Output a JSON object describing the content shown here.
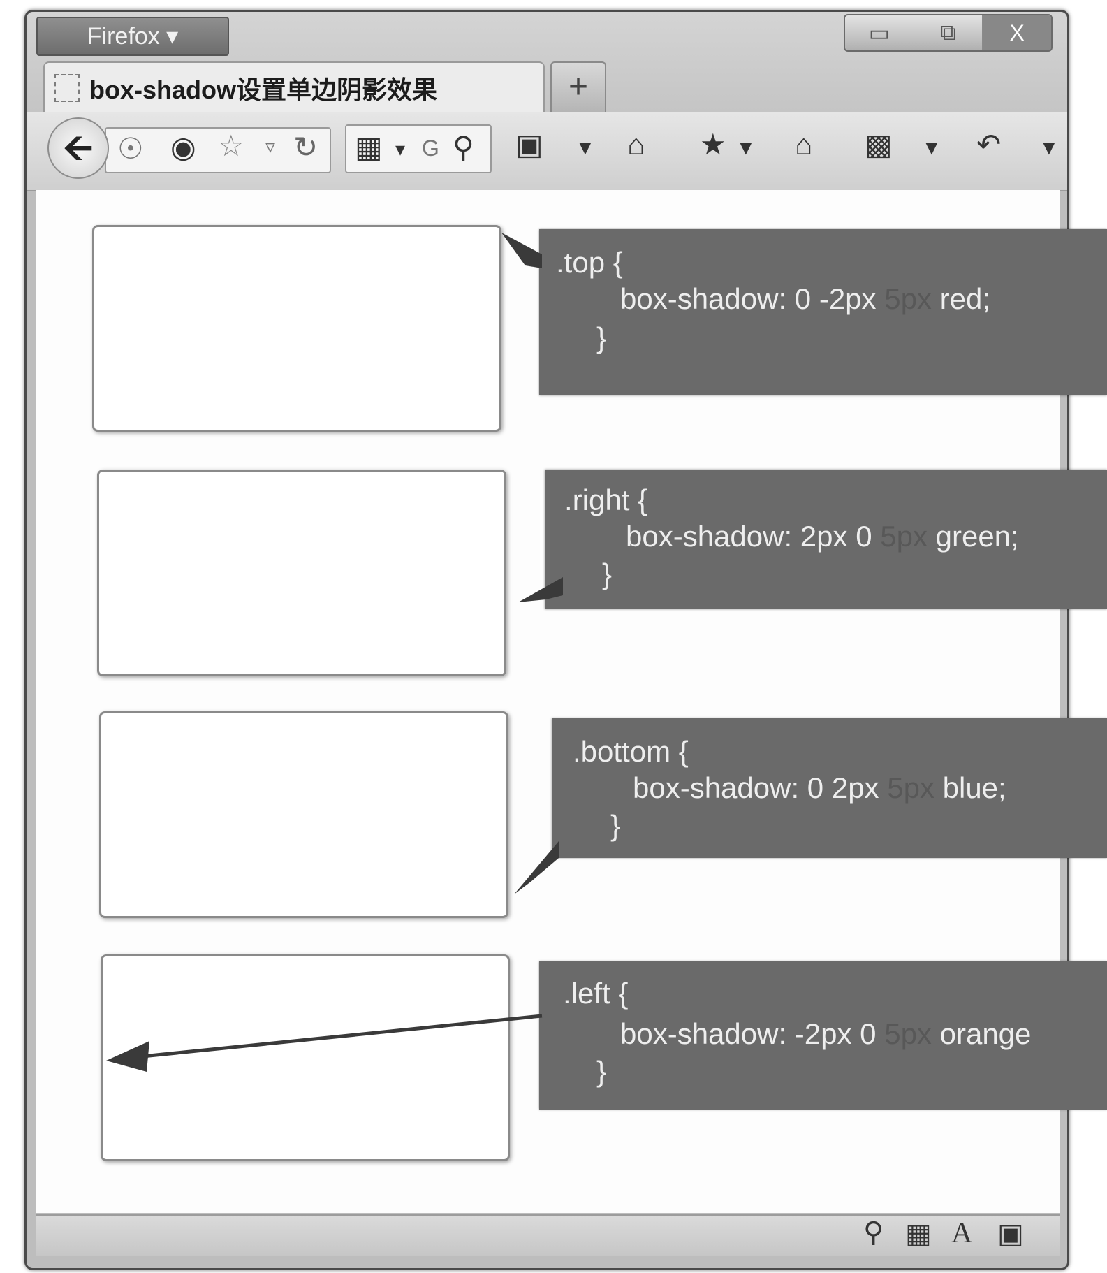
{
  "window": {
    "app_button": "Firefox ▾",
    "controls": [
      "▭",
      "⧉",
      "X"
    ]
  },
  "tab": {
    "title": "box-shadow设置单边阴影效果",
    "new_tab": "+"
  },
  "toolbar": {
    "icons": [
      "back-icon",
      "globe-icon",
      "identity-icon",
      "bookmark-star-icon",
      "dropmarker-icon",
      "reload-icon",
      "search-engine-icon",
      "search-icon",
      "screenshot-icon",
      "home-icon",
      "bookmarks-icon",
      "downloads-icon",
      "addons-icon",
      "undo-icon"
    ]
  },
  "callouts": [
    {
      "selector": ".top {",
      "property": "box-shadow: 0 -2px",
      "blur": "5px",
      "color_value": "red;",
      "close": "}"
    },
    {
      "selector": ".right {",
      "property": "box-shadow: 2px 0",
      "blur": "5px",
      "color_value": "green;",
      "close": "}"
    },
    {
      "selector": ".bottom {",
      "property": "box-shadow: 0 2px",
      "blur": "5px",
      "color_value": "blue;",
      "close": "}"
    },
    {
      "selector": ".left {",
      "property": "box-shadow: -2px 0",
      "blur": "5px",
      "color_value": "orange",
      "close": "}"
    }
  ],
  "statusbar": {
    "icons": [
      "magnifier-icon",
      "reader-icon",
      "font-icon",
      "window-icon"
    ]
  }
}
